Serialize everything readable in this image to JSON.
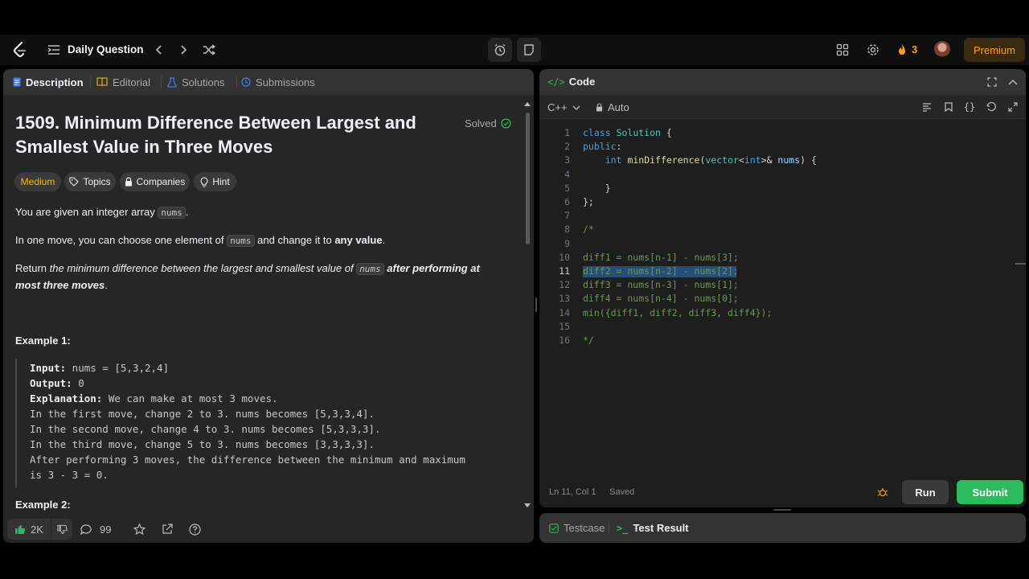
{
  "topbar": {
    "daily_question": "Daily Question",
    "streak_count": "3",
    "premium": "Premium"
  },
  "left": {
    "tabs": [
      {
        "label": "Description",
        "active": true
      },
      {
        "label": "Editorial"
      },
      {
        "label": "Solutions"
      },
      {
        "label": "Submissions"
      }
    ],
    "title_line1": "1509. Minimum Difference Between Largest and",
    "title_line2": "Smallest Value in Three Moves",
    "solved": "Solved",
    "chips": {
      "difficulty": "Medium",
      "topics": "Topics",
      "companies": "Companies",
      "hint": "Hint"
    },
    "p1_a": "You are given an integer array ",
    "p1_code": "nums",
    "p1_b": ".",
    "p2_a": "In one move, you can choose one element of ",
    "p2_code": "nums",
    "p2_b": " and change it to ",
    "p2_bold": "any value",
    "p2_c": ".",
    "p3_a": "Return ",
    "p3_i": "the minimum difference between the largest and smallest value of ",
    "p3_code": "nums",
    "p3_bi": " after performing at",
    "p3_bi2": "most three moves",
    "p3_end": ".",
    "example1_heading": "Example 1:",
    "example1": {
      "input_label": "Input:",
      "input": " nums = [5,3,2,4]",
      "output_label": "Output:",
      "output": " 0",
      "explanation_label": "Explanation:",
      "explanation": " We can make at most 3 moves.",
      "lines": [
        "In the first move, change 2 to 3. nums becomes [5,3,3,4].",
        "In the second move, change 4 to 3. nums becomes [5,3,3,3].",
        "In the third move, change 5 to 3. nums becomes [3,3,3,3].",
        "After performing 3 moves, the difference between the minimum and maximum",
        "is 3 - 3 = 0."
      ]
    },
    "example2_heading": "Example 2:",
    "footer": {
      "likes": "2K",
      "comments": "99"
    }
  },
  "code": {
    "title": "Code",
    "language": "C++",
    "auto": "Auto",
    "lines": [
      "class Solution {",
      "public:",
      "    int minDifference(vector<int>& nums) {",
      "",
      "    }",
      "};",
      "",
      "/*",
      "",
      "diff1 = nums[n-1] - nums[3];",
      "diff2 = nums[n-2] - nums[2];",
      "diff3 = nums[n-3] - nums[1];",
      "diff4 = nums[n-4] - nums[0];",
      "min({diff1, diff2, diff3, diff4});",
      "",
      "*/"
    ],
    "line_numbers": [
      "1",
      "2",
      "3",
      "4",
      "5",
      "6",
      "7",
      "8",
      "9",
      "10",
      "11",
      "12",
      "13",
      "14",
      "15",
      "16"
    ],
    "status": "Ln 11, Col 1",
    "saved": "Saved",
    "run": "Run",
    "submit": "Submit"
  },
  "bottom": {
    "testcase": "Testcase",
    "test_result": "Test Result"
  },
  "colors": {
    "accent_green": "#2cbb5d",
    "medium": "#ffb800",
    "premium": "#ffa116",
    "streak": "#ffa116",
    "selection": "#264f78"
  }
}
